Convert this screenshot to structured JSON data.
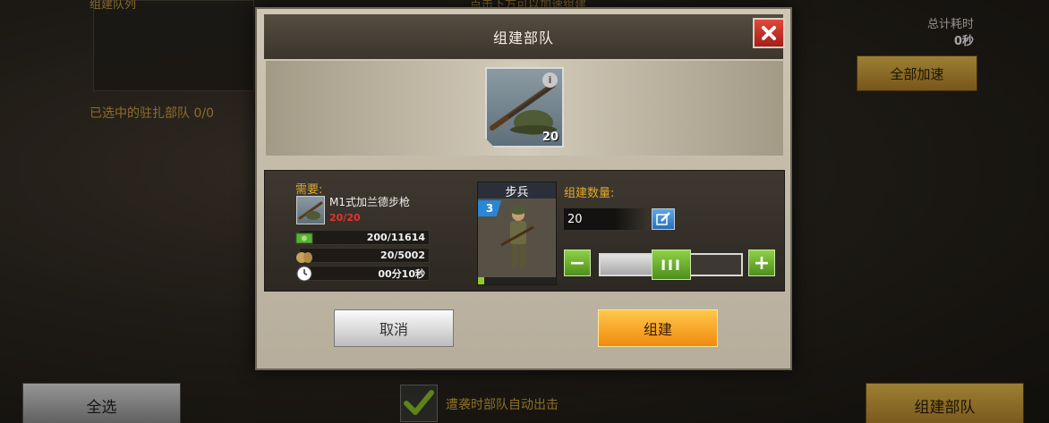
{
  "background": {
    "top_left_text": "组建队列",
    "top_center_text": "点击下方可以加速组建",
    "selected_label": "已选中的驻扎部队 0/0",
    "total_time_label": "总计耗时",
    "total_time_value": "0秒",
    "speedup_all_label": "全部加速",
    "select_all_label": "全选",
    "auto_deploy_label": "遭袭时部队自动出击",
    "build_troops_label": "组建部队"
  },
  "modal": {
    "title": "组建部队",
    "item": {
      "count": "20",
      "info": "i"
    },
    "requirements": {
      "label": "需要:",
      "item_name": "M1式加兰德步枪",
      "item_progress": "20/20",
      "cash": "200/11614",
      "food": "20/5002",
      "time": "00分10秒"
    },
    "unit": {
      "name": "步兵",
      "level": "3"
    },
    "quantity": {
      "label": "组建数量:",
      "value": "20",
      "slider_fraction": 0.5,
      "minus": "−",
      "plus": "+",
      "thumb_grip": "III"
    },
    "cancel_label": "取消",
    "build_label": "组建"
  },
  "colors": {
    "accent_gold": "#e0a92a",
    "cta_orange": "#f08a0f",
    "step_green": "#4e8f1a",
    "close_red": "#c0281c",
    "req_red": "#e4332a"
  }
}
